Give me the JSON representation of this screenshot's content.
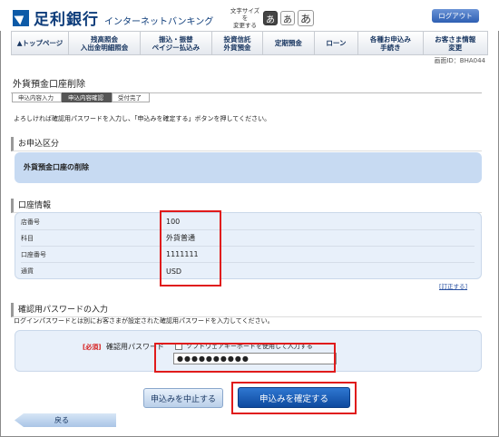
{
  "header": {
    "bank_name": "足利銀行",
    "service_name": "インターネットバンキング",
    "font_size_label_line1": "文字サイズを",
    "font_size_label_line2": "変更する",
    "font_sizes": [
      "あ",
      "あ",
      "あ"
    ],
    "logout": "ログアウト"
  },
  "nav": {
    "items": [
      {
        "line1": "▲トップページ",
        "line2": ""
      },
      {
        "line1": "残高照会",
        "line2": "入出金明細照会"
      },
      {
        "line1": "振込・振替",
        "line2": "ペイジー払込み"
      },
      {
        "line1": "投資信託",
        "line2": "外貨預金"
      },
      {
        "line1": "定期預金",
        "line2": ""
      },
      {
        "line1": "ローン",
        "line2": ""
      },
      {
        "line1": "各種お申込み",
        "line2": "手続き"
      },
      {
        "line1": "お客さま情報",
        "line2": "変更"
      }
    ]
  },
  "screen_id": "画面ID：BHA044",
  "page": {
    "title": "外貨預金口座削除",
    "steps": [
      "申込内容入力",
      "申込内容確認",
      "受付完了"
    ],
    "instruction": "よろしければ確認用パスワードを入力し、「申込みを確定する」ボタンを押してください。"
  },
  "application": {
    "heading": "お申込区分",
    "value": "外貨預金口座の削除"
  },
  "account": {
    "heading": "口座情報",
    "rows": [
      {
        "label": "店番号",
        "value": "100"
      },
      {
        "label": "科目",
        "value": "外貨普通"
      },
      {
        "label": "口座番号",
        "value": "1111111"
      },
      {
        "label": "通貨",
        "value": "USD"
      }
    ],
    "correct_link": "[訂正する]"
  },
  "password": {
    "heading": "確認用パスワードの入力",
    "description": "ログインパスワードとは別にお客さまが設定された確認用パスワードを入力してください。",
    "required_badge": "[必須]",
    "label": "確認用パスワード",
    "software_keyboard": "ソフトウェアキーボードを使用して入力する",
    "masked_value": "●●●●●●●●●●"
  },
  "buttons": {
    "cancel": "申込みを中止する",
    "confirm": "申込みを確定する",
    "back": "戻る"
  },
  "colors": {
    "brand": "#0d3c7a",
    "accent": "#1a5bb5",
    "highlight_box": "#e01b1b",
    "section_fill": "#c7daf2"
  }
}
